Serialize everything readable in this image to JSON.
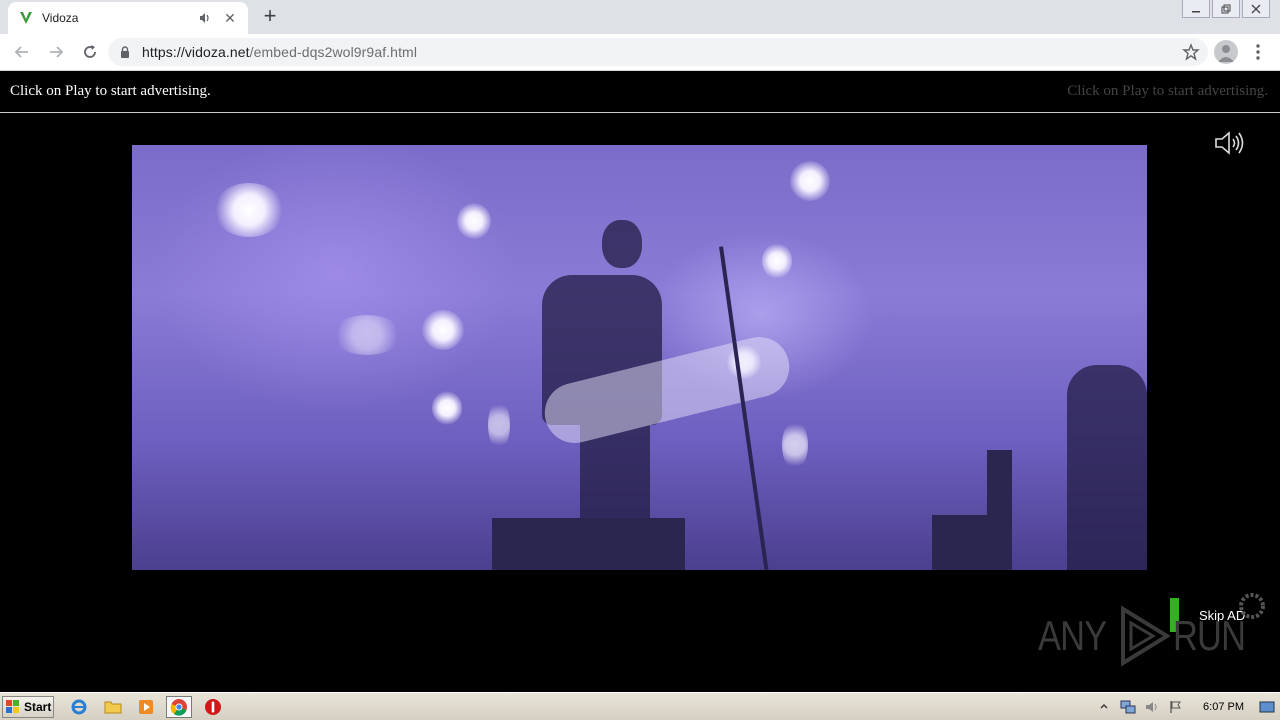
{
  "browser": {
    "tab_title": "Vidoza",
    "tab_close": "✕",
    "new_tab": "+",
    "url_host": "https://vidoza.net",
    "url_path": "/embed-dqs2wol9r9af.html"
  },
  "page": {
    "ad_left": "Click on Play to start advertising.",
    "ad_right": "Click on Play to start advertising.",
    "skip_label": "Skip AD",
    "watermark_left": "ANY",
    "watermark_right": "RUN"
  },
  "taskbar": {
    "start_label": "Start",
    "clock": "6:07 PM"
  },
  "colors": {
    "skip_bar": "#33b21f",
    "favicon": "#3c9a3c"
  }
}
